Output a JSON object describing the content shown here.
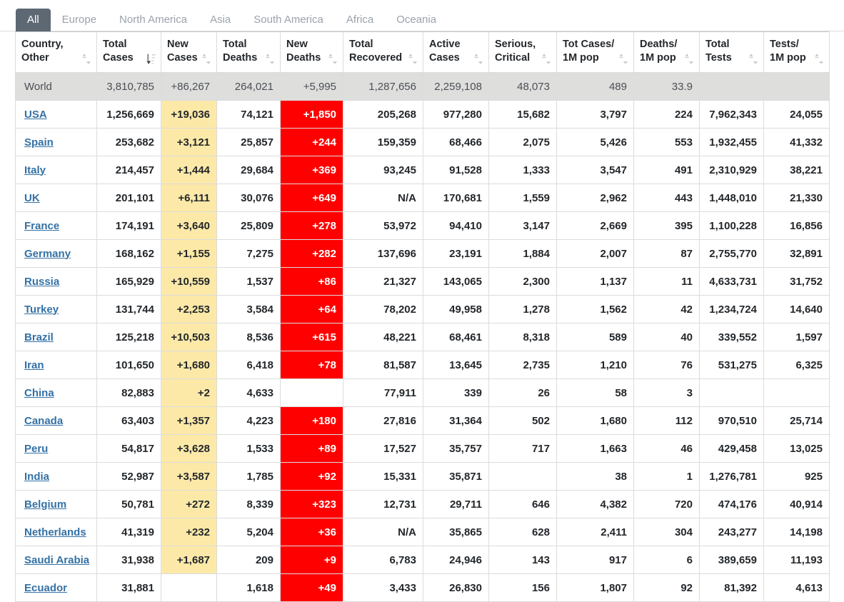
{
  "tabs": [
    {
      "label": "All",
      "active": true
    },
    {
      "label": "Europe",
      "active": false
    },
    {
      "label": "North America",
      "active": false
    },
    {
      "label": "Asia",
      "active": false
    },
    {
      "label": "South America",
      "active": false
    },
    {
      "label": "Africa",
      "active": false
    },
    {
      "label": "Oceania",
      "active": false
    }
  ],
  "colors": {
    "active_tab_bg": "#5d6873",
    "new_cases_bg": "#fce9a8",
    "new_deaths_bg": "#ff0000",
    "world_row_bg": "#dededd",
    "link": "#3471a5"
  },
  "columns": [
    {
      "label": "Country,\nOther",
      "sort": "sort-both-icon"
    },
    {
      "label": "Total\nCases",
      "sort": "sort-desc-active-icon"
    },
    {
      "label": "New\nCases",
      "sort": "sort-both-icon"
    },
    {
      "label": "Total\nDeaths",
      "sort": "sort-both-icon"
    },
    {
      "label": "New\nDeaths",
      "sort": "sort-both-icon"
    },
    {
      "label": "Total\nRecovered",
      "sort": "sort-both-icon"
    },
    {
      "label": "Active\nCases",
      "sort": "sort-both-icon"
    },
    {
      "label": "Serious,\nCritical",
      "sort": "sort-both-icon"
    },
    {
      "label": "Tot Cases/\n1M pop",
      "sort": "sort-both-icon"
    },
    {
      "label": "Deaths/\n1M pop",
      "sort": "sort-both-icon"
    },
    {
      "label": "Total\nTests",
      "sort": "sort-both-icon"
    },
    {
      "label": "Tests/\n1M pop",
      "sort": "sort-both-icon"
    }
  ],
  "rows": [
    {
      "country": "World",
      "is_world": true,
      "link": false,
      "cells": [
        "3,810,785",
        "+86,267",
        "264,021",
        "+5,995",
        "1,287,656",
        "2,259,108",
        "48,073",
        "489",
        "33.9",
        "",
        ""
      ]
    },
    {
      "country": "USA",
      "is_world": false,
      "link": true,
      "cells": [
        "1,256,669",
        "+19,036",
        "74,121",
        "+1,850",
        "205,268",
        "977,280",
        "15,682",
        "3,797",
        "224",
        "7,962,343",
        "24,055"
      ]
    },
    {
      "country": "Spain",
      "is_world": false,
      "link": true,
      "cells": [
        "253,682",
        "+3,121",
        "25,857",
        "+244",
        "159,359",
        "68,466",
        "2,075",
        "5,426",
        "553",
        "1,932,455",
        "41,332"
      ]
    },
    {
      "country": "Italy",
      "is_world": false,
      "link": true,
      "cells": [
        "214,457",
        "+1,444",
        "29,684",
        "+369",
        "93,245",
        "91,528",
        "1,333",
        "3,547",
        "491",
        "2,310,929",
        "38,221"
      ]
    },
    {
      "country": "UK",
      "is_world": false,
      "link": true,
      "cells": [
        "201,101",
        "+6,111",
        "30,076",
        "+649",
        "N/A",
        "170,681",
        "1,559",
        "2,962",
        "443",
        "1,448,010",
        "21,330"
      ]
    },
    {
      "country": "France",
      "is_world": false,
      "link": true,
      "cells": [
        "174,191",
        "+3,640",
        "25,809",
        "+278",
        "53,972",
        "94,410",
        "3,147",
        "2,669",
        "395",
        "1,100,228",
        "16,856"
      ]
    },
    {
      "country": "Germany",
      "is_world": false,
      "link": true,
      "cells": [
        "168,162",
        "+1,155",
        "7,275",
        "+282",
        "137,696",
        "23,191",
        "1,884",
        "2,007",
        "87",
        "2,755,770",
        "32,891"
      ]
    },
    {
      "country": "Russia",
      "is_world": false,
      "link": true,
      "cells": [
        "165,929",
        "+10,559",
        "1,537",
        "+86",
        "21,327",
        "143,065",
        "2,300",
        "1,137",
        "11",
        "4,633,731",
        "31,752"
      ]
    },
    {
      "country": "Turkey",
      "is_world": false,
      "link": true,
      "cells": [
        "131,744",
        "+2,253",
        "3,584",
        "+64",
        "78,202",
        "49,958",
        "1,278",
        "1,562",
        "42",
        "1,234,724",
        "14,640"
      ]
    },
    {
      "country": "Brazil",
      "is_world": false,
      "link": true,
      "cells": [
        "125,218",
        "+10,503",
        "8,536",
        "+615",
        "48,221",
        "68,461",
        "8,318",
        "589",
        "40",
        "339,552",
        "1,597"
      ]
    },
    {
      "country": "Iran",
      "is_world": false,
      "link": true,
      "cells": [
        "101,650",
        "+1,680",
        "6,418",
        "+78",
        "81,587",
        "13,645",
        "2,735",
        "1,210",
        "76",
        "531,275",
        "6,325"
      ]
    },
    {
      "country": "China",
      "is_world": false,
      "link": true,
      "cells": [
        "82,883",
        "+2",
        "4,633",
        "",
        "77,911",
        "339",
        "26",
        "58",
        "3",
        "",
        ""
      ]
    },
    {
      "country": "Canada",
      "is_world": false,
      "link": true,
      "cells": [
        "63,403",
        "+1,357",
        "4,223",
        "+180",
        "27,816",
        "31,364",
        "502",
        "1,680",
        "112",
        "970,510",
        "25,714"
      ]
    },
    {
      "country": "Peru",
      "is_world": false,
      "link": true,
      "cells": [
        "54,817",
        "+3,628",
        "1,533",
        "+89",
        "17,527",
        "35,757",
        "717",
        "1,663",
        "46",
        "429,458",
        "13,025"
      ]
    },
    {
      "country": "India",
      "is_world": false,
      "link": true,
      "cells": [
        "52,987",
        "+3,587",
        "1,785",
        "+92",
        "15,331",
        "35,871",
        "",
        "38",
        "1",
        "1,276,781",
        "925"
      ]
    },
    {
      "country": "Belgium",
      "is_world": false,
      "link": true,
      "cells": [
        "50,781",
        "+272",
        "8,339",
        "+323",
        "12,731",
        "29,711",
        "646",
        "4,382",
        "720",
        "474,176",
        "40,914"
      ]
    },
    {
      "country": "Netherlands",
      "is_world": false,
      "link": true,
      "cells": [
        "41,319",
        "+232",
        "5,204",
        "+36",
        "N/A",
        "35,865",
        "628",
        "2,411",
        "304",
        "243,277",
        "14,198"
      ]
    },
    {
      "country": "Saudi Arabia",
      "is_world": false,
      "link": true,
      "cells": [
        "31,938",
        "+1,687",
        "209",
        "+9",
        "6,783",
        "24,946",
        "143",
        "917",
        "6",
        "389,659",
        "11,193"
      ]
    },
    {
      "country": "Ecuador",
      "is_world": false,
      "link": true,
      "cells": [
        "31,881",
        "",
        "1,618",
        "+49",
        "3,433",
        "26,830",
        "156",
        "1,807",
        "92",
        "81,392",
        "4,613"
      ]
    }
  ]
}
